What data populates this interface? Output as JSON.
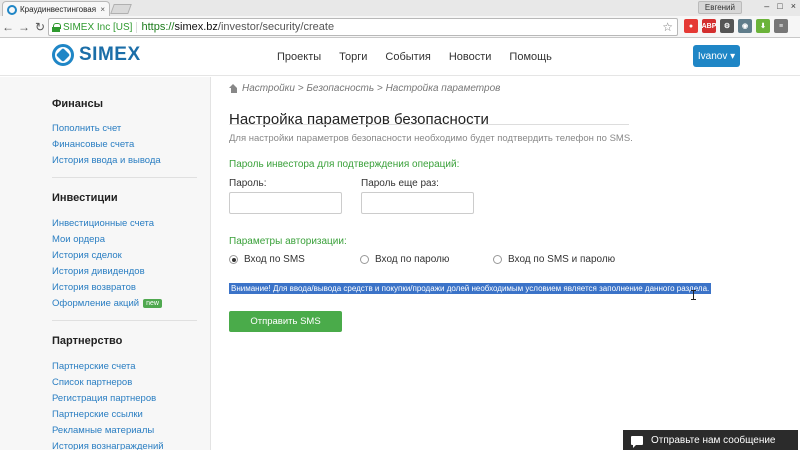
{
  "browser": {
    "tab_title": "Краудинвестинговая пла",
    "tab_close": "×",
    "user_name": "Евгений",
    "window_controls": [
      "–",
      "□",
      "×"
    ],
    "cert_label": "SIMEX Inc [US]",
    "url_scheme": "https://",
    "url_host": "simex.bz",
    "url_path": "/investor/security/create",
    "extensions": [
      {
        "icon": "stop-icon",
        "label": "●",
        "color": "#e53935"
      },
      {
        "icon": "adblock-icon",
        "label": "ABP",
        "color": "#d32f2f"
      },
      {
        "icon": "gear-icon",
        "label": "⚙",
        "color": "#555555"
      },
      {
        "icon": "eye-icon",
        "label": "◉",
        "color": "#607d8b"
      },
      {
        "icon": "download-icon",
        "label": "⬇",
        "color": "#6bb33a"
      },
      {
        "icon": "menu-icon",
        "label": "≡",
        "color": "#777777"
      }
    ]
  },
  "header": {
    "logo_text": "SIMEX",
    "nav": [
      "Проекты",
      "Торги",
      "События",
      "Новости",
      "Помощь"
    ],
    "user_button": "Ivanov ▾",
    "accent": "#1f86c6"
  },
  "sidebar": {
    "sections": [
      {
        "title": "Финансы",
        "items": [
          {
            "label": "Пополнить счет"
          },
          {
            "label": "Финансовые счета"
          },
          {
            "label": "История ввода и вывода"
          }
        ]
      },
      {
        "title": "Инвестиции",
        "items": [
          {
            "label": "Инвестиционные счета"
          },
          {
            "label": "Мои ордера"
          },
          {
            "label": "История сделок"
          },
          {
            "label": "История дивидендов"
          },
          {
            "label": "История возвратов"
          },
          {
            "label": "Оформление акций",
            "badge": "new"
          }
        ]
      },
      {
        "title": "Партнерство",
        "items": [
          {
            "label": "Партнерские счета"
          },
          {
            "label": "Список партнеров"
          },
          {
            "label": "Регистрация партнеров"
          },
          {
            "label": "Партнерские ссылки"
          },
          {
            "label": "Рекламные материалы"
          },
          {
            "label": "История вознаграждений"
          }
        ]
      }
    ]
  },
  "main": {
    "breadcrumb": [
      "Настройки",
      "Безопасность",
      "Настройка параметров"
    ],
    "title": "Настройка параметров безопасности",
    "description": "Для настройки параметров безопасности необходимо будет подтвердить телефон по SMS.",
    "investor_password_section": "Пароль инвестора для подтверждения операций:",
    "password_label": "Пароль:",
    "password_repeat_label": "Пароль еще раз:",
    "auth_section": "Параметры авторизации:",
    "auth_options": [
      {
        "label": "Вход по SMS",
        "checked": true
      },
      {
        "label": "Вход по паролю",
        "checked": false
      },
      {
        "label": "Вход по SMS и паролю",
        "checked": false
      }
    ],
    "warning": "Внимание! Для ввода/вывода средств и покупки/продажи долей необходимым условием является заполнение данного раздела.",
    "submit": "Отправить SMS"
  },
  "chat": {
    "label": "Отправьте нам сообщение"
  }
}
